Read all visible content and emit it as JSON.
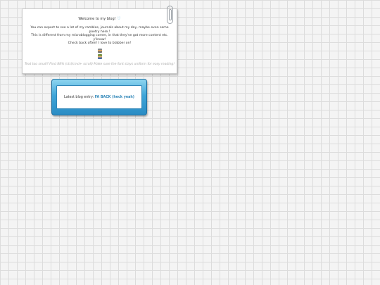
{
  "note": {
    "title": "Welcome to my blog!",
    "heart_glyph": "♡",
    "intro_lines": [
      "You can expect to see a lot of my rambles, journals about my day, maybe even some poetry here.!",
      "This is different from my microblogging corner, in that they've got more content etc. y'know!",
      "Check back often! I love to blabber on!"
    ],
    "tagline": "Text too small? Find 88% (ctrl/cmd+ scroll) Make sure the font stays uniform for easy reading!",
    "icons": [
      "pixel-sprite-icon",
      "pixel-sprite-icon"
    ]
  },
  "blog_box": {
    "prefix": "Latest blog entry: ",
    "link_label": "FA BACK (heck yeah)"
  },
  "colors": {
    "accent": "#2e86b8",
    "box_gradient_top": "#8fd5f0",
    "box_gradient_bottom": "#2a8cc4"
  }
}
